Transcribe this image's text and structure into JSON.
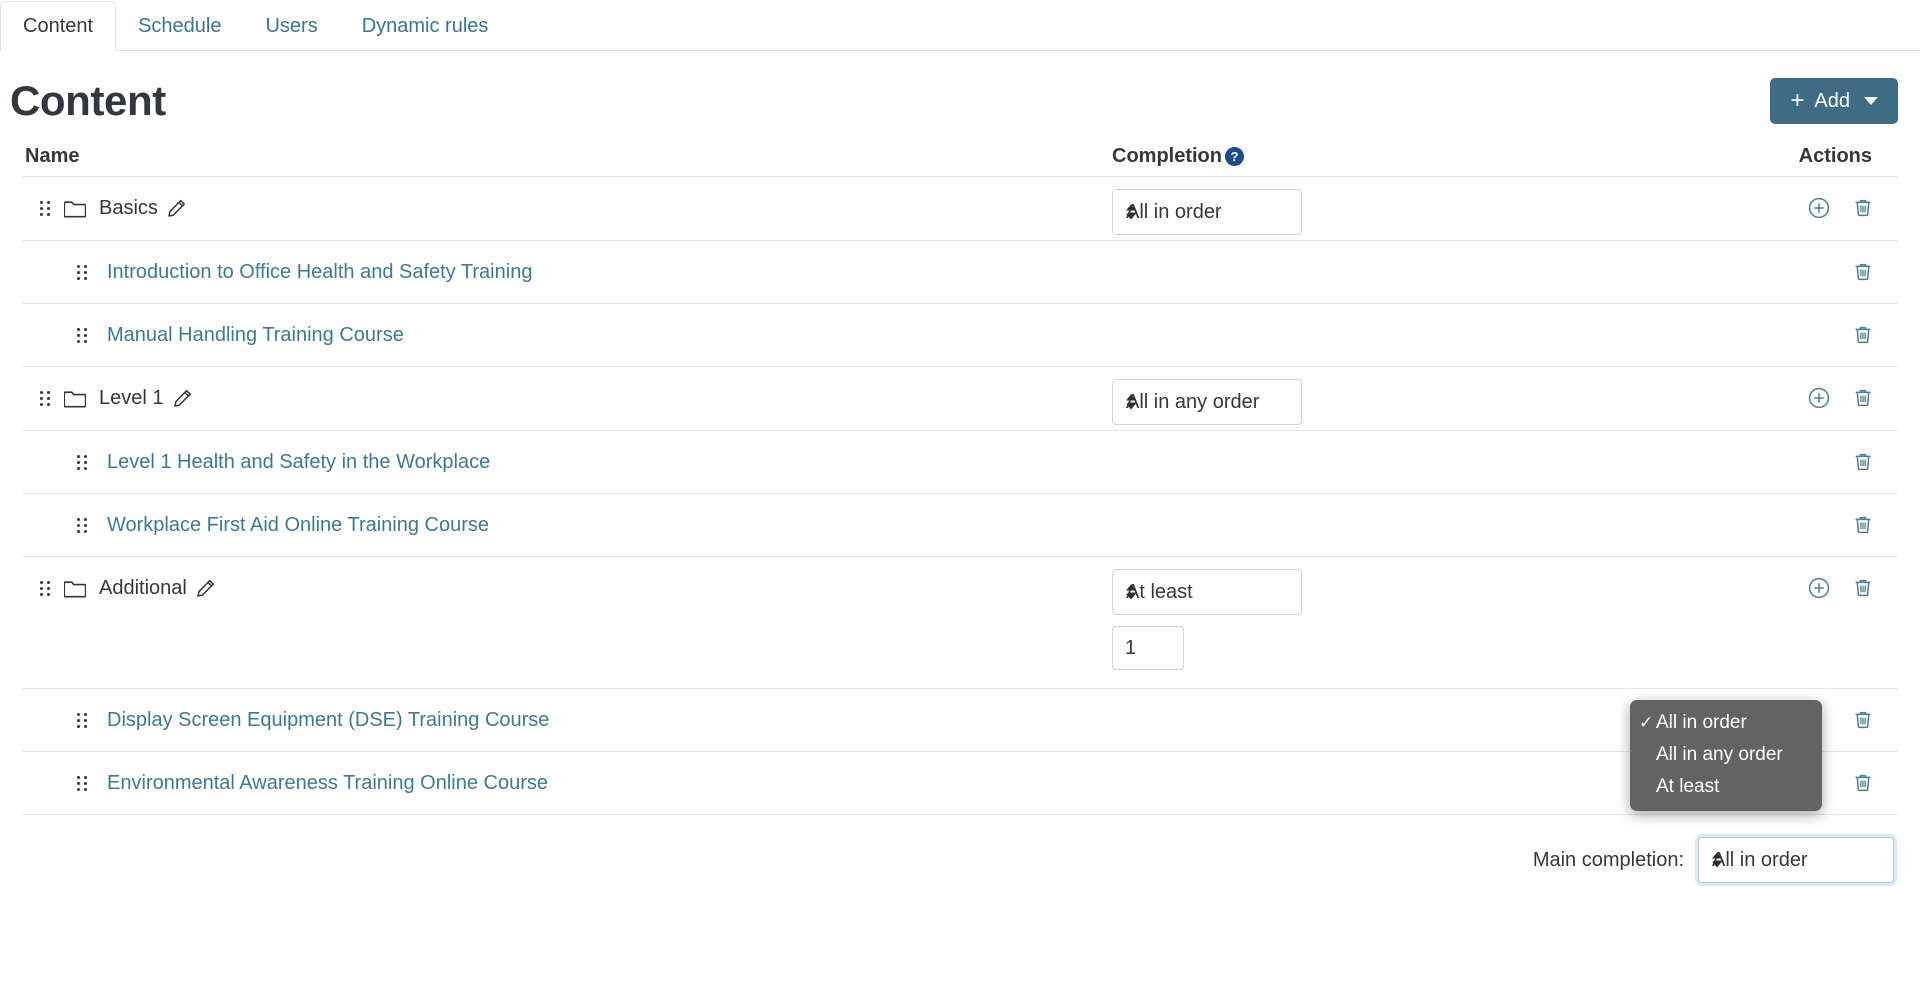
{
  "tabs": [
    {
      "label": "Content",
      "active": true
    },
    {
      "label": "Schedule",
      "active": false
    },
    {
      "label": "Users",
      "active": false
    },
    {
      "label": "Dynamic rules",
      "active": false
    }
  ],
  "header": {
    "title": "Content",
    "add_button": "Add"
  },
  "table": {
    "columns": {
      "name": "Name",
      "completion": "Completion",
      "actions": "Actions",
      "completion_help": "?"
    },
    "rows": [
      {
        "type": "group",
        "label": "Basics",
        "completion": "All in order",
        "amount": null
      },
      {
        "type": "child",
        "label": "Introduction to Office Health and Safety Training"
      },
      {
        "type": "child",
        "label": "Manual Handling Training Course"
      },
      {
        "type": "group",
        "label": "Level 1",
        "completion": "All in any order",
        "amount": null
      },
      {
        "type": "child",
        "label": "Level 1 Health and Safety in the Workplace"
      },
      {
        "type": "child",
        "label": "Workplace First Aid Online Training Course"
      },
      {
        "type": "group",
        "label": "Additional",
        "completion": "At least",
        "amount": "1"
      },
      {
        "type": "child",
        "label": "Display Screen Equipment (DSE) Training Course"
      },
      {
        "type": "child",
        "label": "Environmental Awareness Training Online Course"
      }
    ]
  },
  "footer": {
    "label": "Main completion:",
    "value": "All in order"
  },
  "popup": {
    "options": [
      {
        "label": "All in order",
        "selected": true,
        "check": "✓"
      },
      {
        "label": "All in any order",
        "selected": false,
        "check": ""
      },
      {
        "label": "At least",
        "selected": false,
        "check": ""
      }
    ]
  },
  "icons": {
    "drag": "drag-handle-icon",
    "folder": "folder-icon",
    "pencil": "pencil-edit-icon",
    "plus_circle": "plus-circle-icon",
    "trash": "trash-icon"
  },
  "colors": {
    "accent": "#3f6c85",
    "link": "#40798f",
    "help": "#1e4c8a",
    "border": "#dee2e6",
    "popup_bg": "#636363"
  }
}
